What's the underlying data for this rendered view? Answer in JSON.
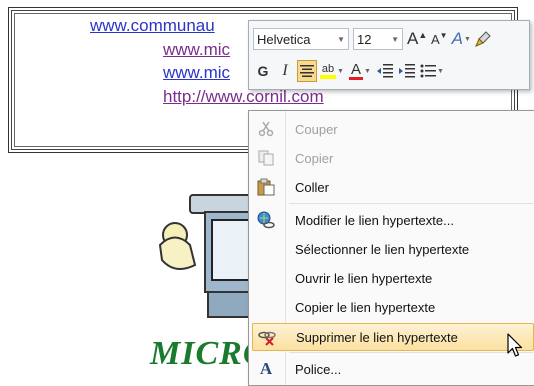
{
  "document": {
    "links": [
      "www.communau",
      "www.mic",
      "www.mic",
      "http://www.cornil.com"
    ],
    "logo_text": "MICRO"
  },
  "toolbar": {
    "font_name": "Helvetica",
    "font_size": "12",
    "grow_font": "A",
    "shrink_font": "A",
    "style_label": "A",
    "bold": "G",
    "italic": "I",
    "highlight_label": "ab",
    "font_color_label": "A"
  },
  "context_menu": {
    "items": [
      {
        "label": "Couper",
        "enabled": false,
        "icon": "scissors-icon"
      },
      {
        "label": "Copier",
        "enabled": false,
        "icon": "copy-icon"
      },
      {
        "label": "Coller",
        "enabled": true,
        "icon": "paste-icon"
      },
      {
        "label": "Modifier le lien hypertexte...",
        "enabled": true,
        "icon": "edit-hyperlink-icon"
      },
      {
        "label": "Sélectionner le lien hypertexte",
        "enabled": true,
        "icon": ""
      },
      {
        "label": "Ouvrir le lien hypertexte",
        "enabled": true,
        "icon": ""
      },
      {
        "label": "Copier le lien hypertexte",
        "enabled": true,
        "icon": ""
      },
      {
        "label": "Supprimer le lien hypertexte",
        "enabled": true,
        "icon": "remove-hyperlink-icon",
        "highlighted": true
      },
      {
        "label": "Police...",
        "enabled": true,
        "icon": "font-icon"
      }
    ]
  },
  "colors": {
    "highlight_bg": "#fbe0a0",
    "link_blue": "#2b35c8",
    "link_visited": "#7b2d8e",
    "logo_green": "#1a7b2f"
  }
}
